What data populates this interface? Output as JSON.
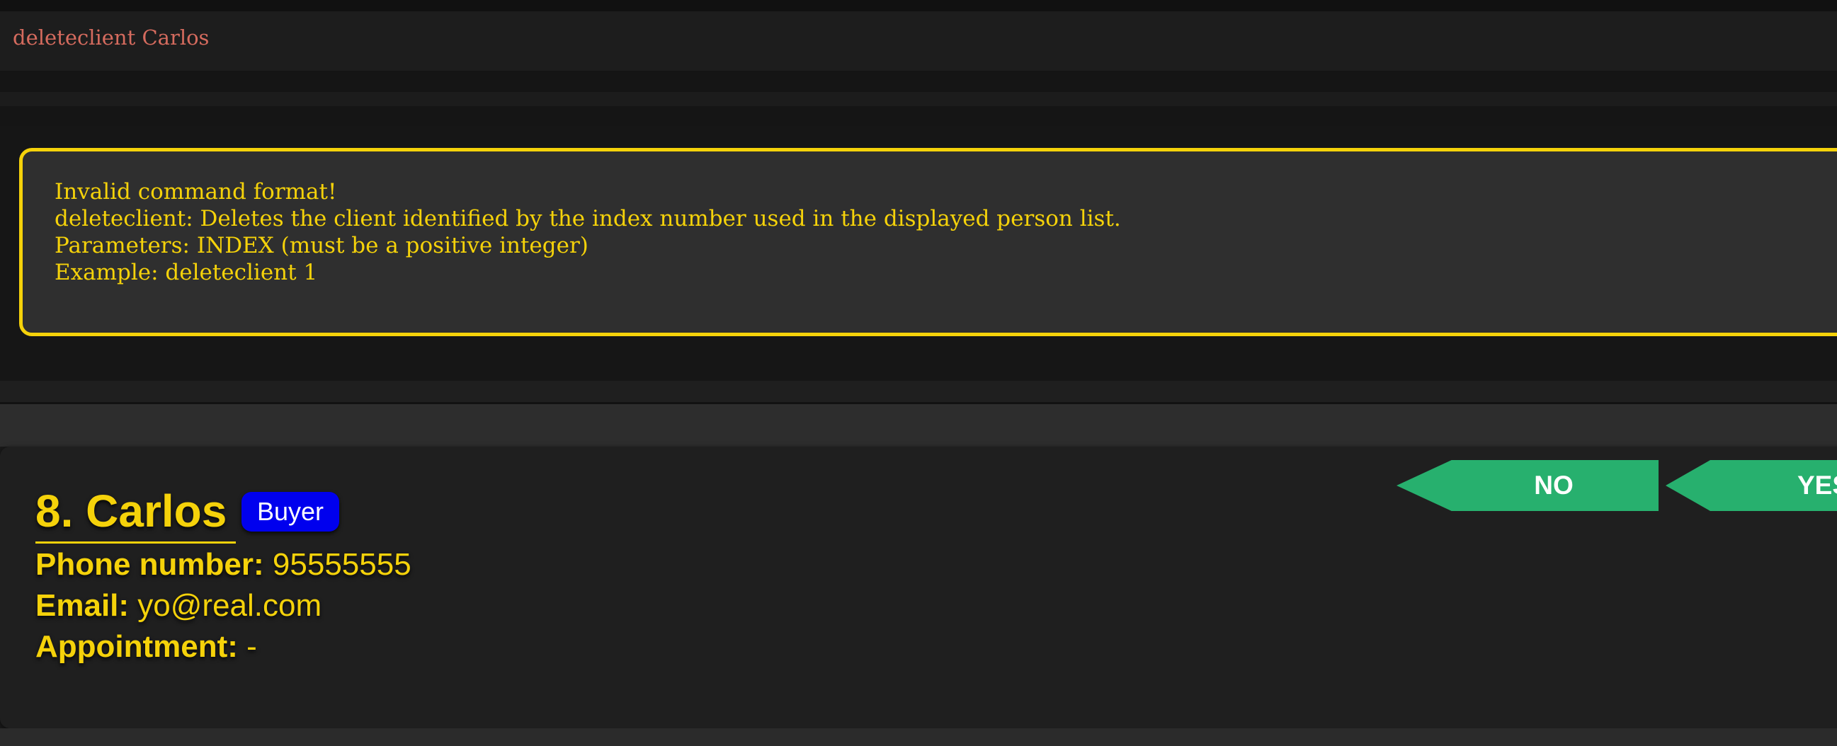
{
  "command_box": {
    "text": "deleteclient Carlos"
  },
  "result_display": {
    "lines": [
      "Invalid command format!",
      "deleteclient: Deletes the client identified by the index number used in the displayed person list.",
      "Parameters: INDEX (must be a positive integer)",
      "Example: deleteclient 1"
    ]
  },
  "person_card": {
    "index_name": "8. Carlos",
    "tag": "Buyer",
    "phone_label": "Phone number:",
    "phone_value": "95555555",
    "email_label": "Email:",
    "email_value": "yo@real.com",
    "appointment_label": "Appointment:",
    "appointment_value": "-"
  },
  "confirm_buttons": {
    "no_label": "NO",
    "yes_label": "YES"
  },
  "colors": {
    "accent": "#f5d20a",
    "command_text": "#d56b5e",
    "tag_bg": "#0000ee",
    "button_bg": "#27b06e",
    "background": "#1a1a1a"
  }
}
